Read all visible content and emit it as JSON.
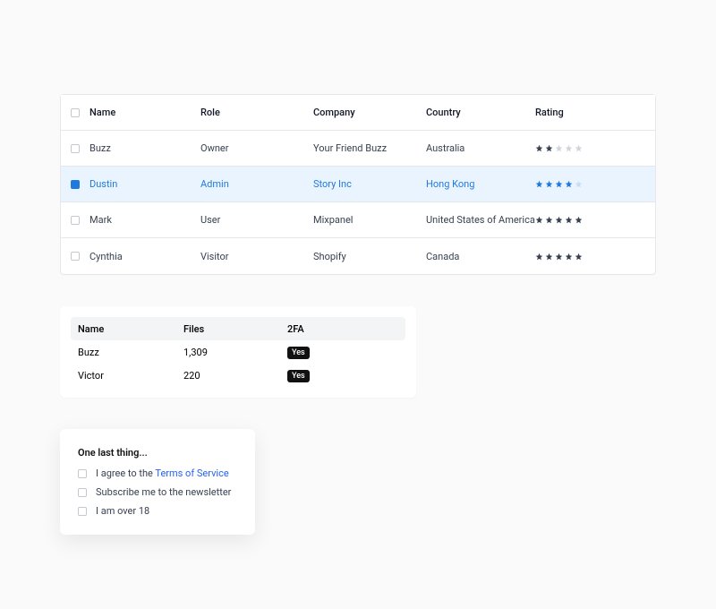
{
  "mainTable": {
    "headers": {
      "name": "Name",
      "role": "Role",
      "company": "Company",
      "country": "Country",
      "rating": "Rating"
    },
    "rows": [
      {
        "selected": false,
        "name": "Buzz",
        "role": "Owner",
        "company": "Your Friend Buzz",
        "country": "Australia",
        "rating": 2
      },
      {
        "selected": true,
        "name": "Dustin",
        "role": "Admin",
        "company": "Story Inc",
        "country": "Hong Kong",
        "rating": 4
      },
      {
        "selected": false,
        "name": "Mark",
        "role": "User",
        "company": "Mixpanel",
        "country": "United States of America",
        "rating": 5
      },
      {
        "selected": false,
        "name": "Cynthia",
        "role": "Visitor",
        "company": "Shopify",
        "country": "Canada",
        "rating": 5
      }
    ]
  },
  "smallTable": {
    "headers": {
      "name": "Name",
      "files": "Files",
      "twofa": "2FA"
    },
    "rows": [
      {
        "name": "Buzz",
        "files": "1,309",
        "twofa": "Yes"
      },
      {
        "name": "Victor",
        "files": "220",
        "twofa": "Yes"
      }
    ]
  },
  "consent": {
    "title": "One last thing...",
    "opt1_pre": "I agree to the ",
    "opt1_link": "Terms of Service",
    "opt2": "Subscribe me to the newsletter",
    "opt3": "I am over 18"
  }
}
